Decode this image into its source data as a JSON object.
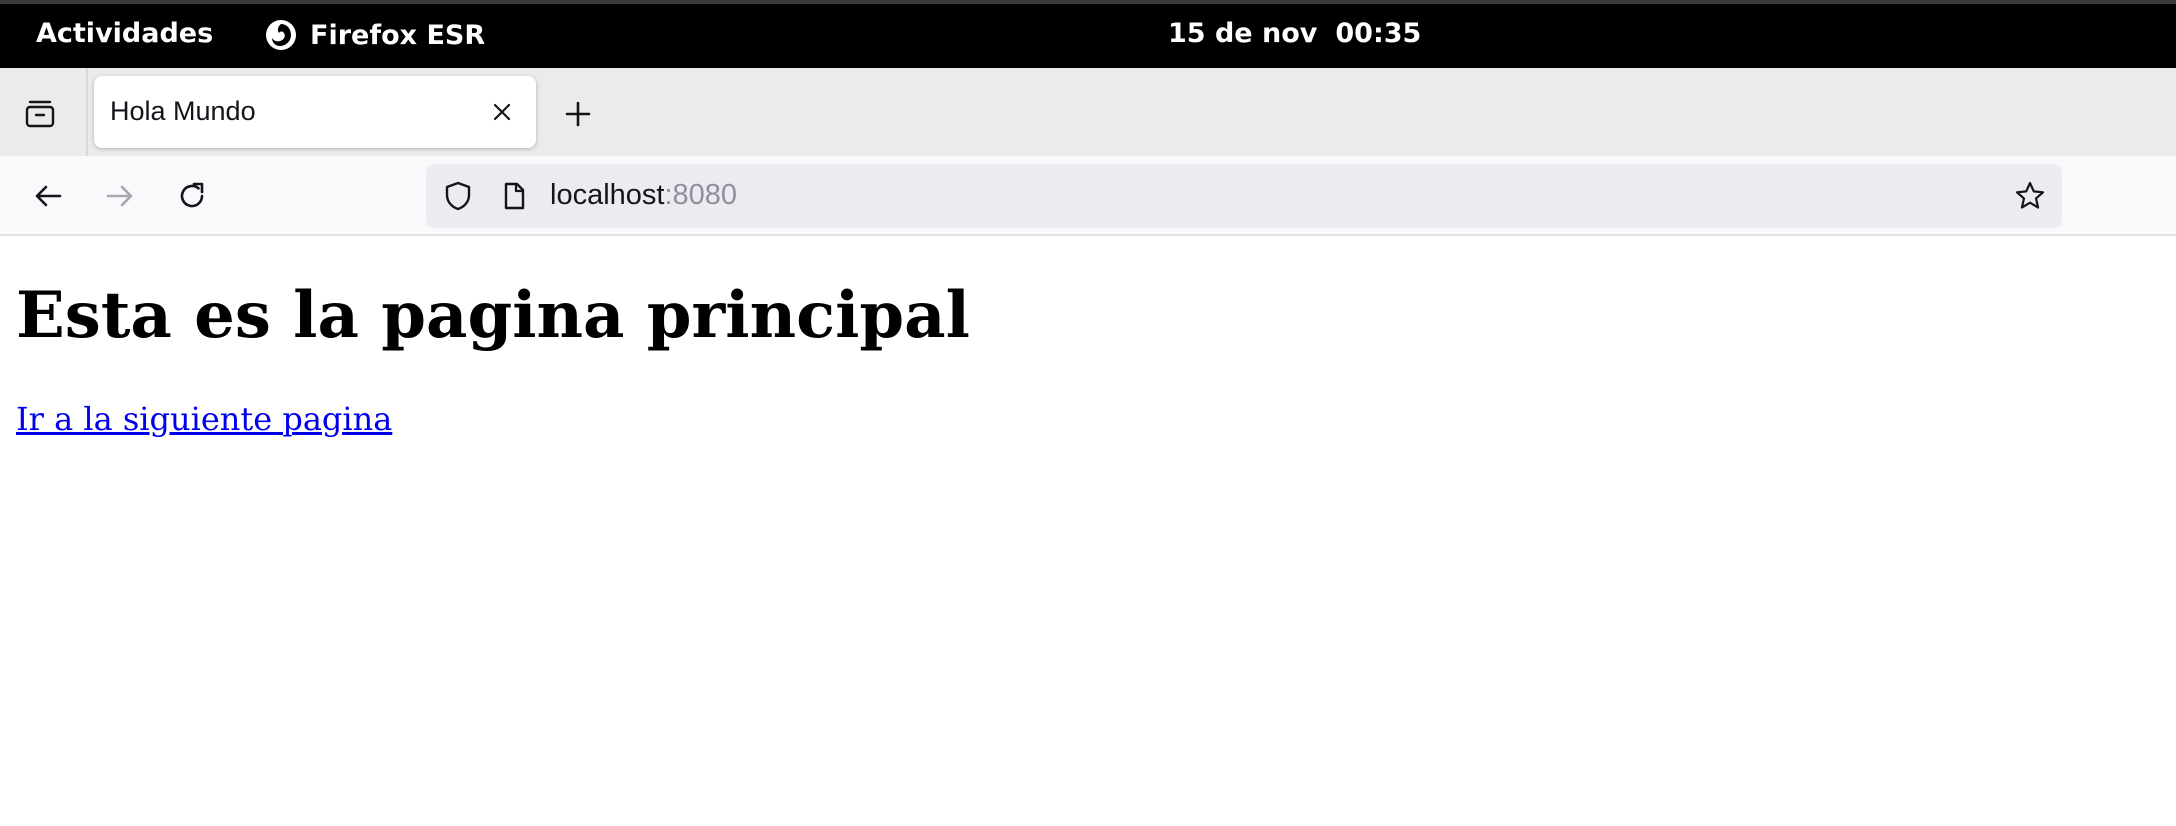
{
  "topbar": {
    "activities_label": "Actividades",
    "app_name": "Firefox ESR",
    "date": "15 de nov",
    "time": "00:35"
  },
  "browser": {
    "tab": {
      "title": "Hola Mundo"
    },
    "urlbar": {
      "host": "localhost",
      "port": ":8080"
    }
  },
  "page": {
    "heading": "Esta es la pagina principal",
    "link_text": "Ir a la siguiente pagina"
  },
  "colors": {
    "link": "#0000ee",
    "topbar_bg": "#000000",
    "tabstrip_bg": "#ebebeb",
    "urlbar_bg": "#ececf0"
  },
  "icons": {
    "tab_overview": "tab-overview-icon",
    "firefox": "firefox-icon",
    "close_tab": "close-icon",
    "new_tab": "plus-icon",
    "back": "arrow-left-icon",
    "forward": "arrow-right-icon",
    "reload": "reload-icon",
    "tracking_protection": "shield-icon",
    "page_info": "page-icon",
    "bookmark": "star-icon"
  }
}
